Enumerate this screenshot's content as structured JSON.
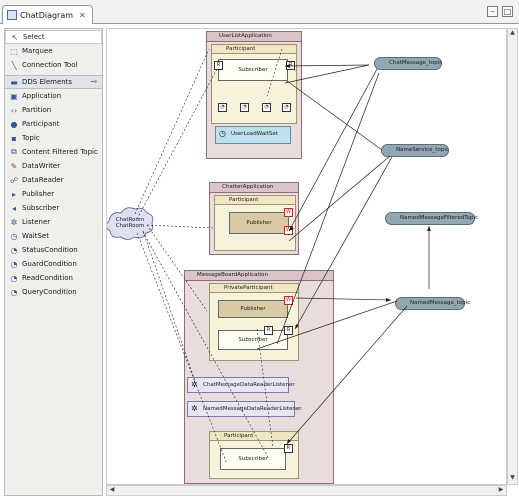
{
  "editor": {
    "tab_title": "ChatDiagram",
    "tab_close": "✕",
    "minimize": "–",
    "maximize": "□"
  },
  "palette": {
    "tools": [
      {
        "label": "Select",
        "icon": "select-arrow-icon"
      },
      {
        "label": "Marquee",
        "icon": "marquee-icon"
      },
      {
        "label": "Connection Tool",
        "icon": "connection-tool-icon"
      }
    ],
    "drawer": {
      "label": "DDS Elements",
      "pin": "📌"
    },
    "elements": [
      {
        "label": "Application",
        "icon": "application-icon"
      },
      {
        "label": "Partition",
        "icon": "partition-icon"
      },
      {
        "label": "Participant",
        "icon": "participant-icon"
      },
      {
        "label": "Topic",
        "icon": "topic-icon"
      },
      {
        "label": "Content Filtered Topic",
        "icon": "content-filtered-topic-icon"
      },
      {
        "label": "DataWriter",
        "icon": "datawriter-icon"
      },
      {
        "label": "DataReader",
        "icon": "datareader-icon"
      },
      {
        "label": "Publisher",
        "icon": "publisher-icon"
      },
      {
        "label": "Subscriber",
        "icon": "subscriber-icon"
      },
      {
        "label": "Listener",
        "icon": "listener-icon"
      },
      {
        "label": "WaitSet",
        "icon": "waitset-icon"
      },
      {
        "label": "StatusCondition",
        "icon": "status-condition-icon"
      },
      {
        "label": "GuardCondition",
        "icon": "guard-condition-icon"
      },
      {
        "label": "ReadCondition",
        "icon": "read-condition-icon"
      },
      {
        "label": "QueryCondition",
        "icon": "query-condition-icon"
      }
    ]
  },
  "diagram": {
    "apps": [
      {
        "title": "UserListApplication"
      },
      {
        "title": "ChatterApplication"
      },
      {
        "title": "MessageBoardApplication"
      }
    ],
    "participants": {
      "userlist": "Participant",
      "chatter": "Participant",
      "board_private": "PrivateParticipant",
      "board_public": "Participant"
    },
    "entities": {
      "userlist_subscriber": "Subscriber",
      "userlist_listener": "UserLoadWaitSet",
      "chatter_publisher": "Publisher",
      "board_publisher": "Publisher",
      "board_subscriber1": "Subscriber",
      "board_subscriber2": "Subscriber",
      "listener1": "ChatMessageDataReaderListener",
      "listener2": "NamedMessageDataReaderListener"
    },
    "topics": {
      "chat": "ChatMessage_topic",
      "nameservice": "NameService_topic",
      "namedmsgfiltered": "NamedMessageFilteredTopic",
      "namedmsg": "NamedMessage_topic"
    },
    "partition": {
      "line1": "ChatRoom",
      "line2": "ChatRoom"
    },
    "port_labels": {
      "writer": "W",
      "reader": "R"
    }
  },
  "colors": {
    "app": "#eadbdd",
    "participant": "#f7f2dc",
    "topic": "#93a7b3",
    "listener": "#e8e6f4"
  }
}
